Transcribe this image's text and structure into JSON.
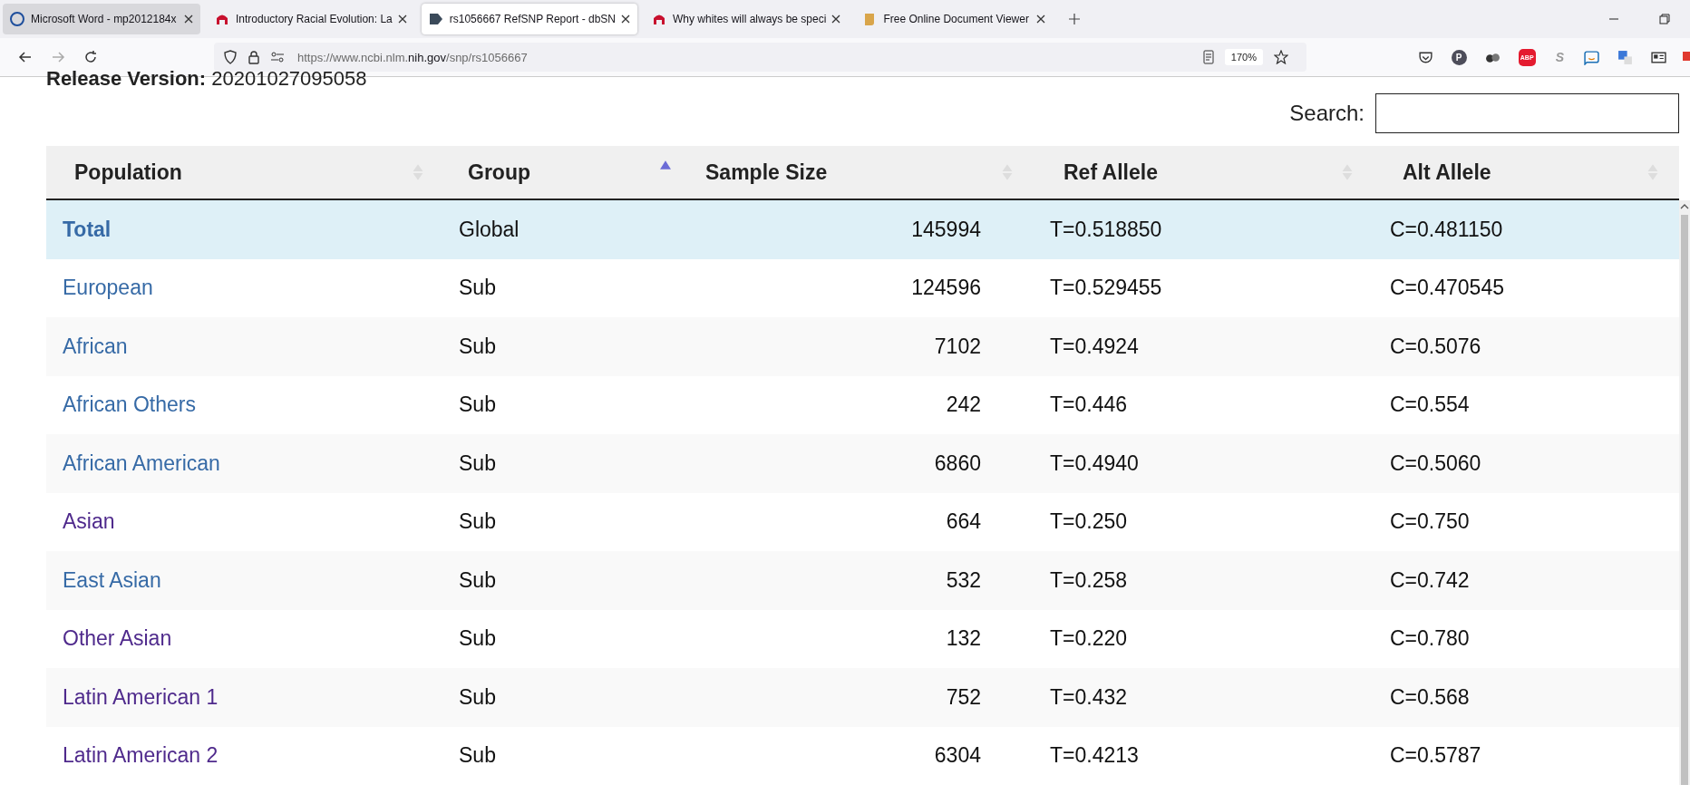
{
  "browser": {
    "tabs": [
      {
        "title": "Microsoft Word - mp2012184x",
        "selected": false,
        "kind": "globe"
      },
      {
        "title": "Introductory Racial Evolution: La",
        "selected": false,
        "kind": "hat"
      },
      {
        "title": "rs1056667 RefSNP Report - dbSN",
        "selected": true,
        "kind": "tag"
      },
      {
        "title": "Why whites will always be speci",
        "selected": false,
        "kind": "hat"
      },
      {
        "title": "Free Online Document Viewer",
        "selected": false,
        "kind": "scroll"
      }
    ],
    "url": {
      "prefix": "https://www.ncbi.nlm.",
      "domain": "nih.gov",
      "path": "/snp/rs1056667"
    },
    "zoom": "170%",
    "extensions": [
      "P",
      "ABP",
      "S"
    ]
  },
  "page": {
    "release": {
      "label": "Release Version:",
      "value": "20201027095058"
    },
    "search": {
      "label": "Search:"
    },
    "table": {
      "columns": [
        {
          "label": "Population",
          "sorted": false
        },
        {
          "label": "Group",
          "sorted": true
        },
        {
          "label": "Sample Size",
          "sorted": false
        },
        {
          "label": "Ref Allele",
          "sorted": false
        },
        {
          "label": "Alt Allele",
          "sorted": false
        }
      ],
      "rows": [
        {
          "population": "Total",
          "visited": false,
          "highlighted": true,
          "group": "Global",
          "sample_size": "145994",
          "ref_allele": "T=0.518850",
          "alt_allele": "C=0.481150"
        },
        {
          "population": "European",
          "visited": false,
          "highlighted": false,
          "group": "Sub",
          "sample_size": "124596",
          "ref_allele": "T=0.529455",
          "alt_allele": "C=0.470545"
        },
        {
          "population": "African",
          "visited": false,
          "highlighted": false,
          "group": "Sub",
          "sample_size": "7102",
          "ref_allele": "T=0.4924",
          "alt_allele": "C=0.5076"
        },
        {
          "population": "African Others",
          "visited": false,
          "highlighted": false,
          "group": "Sub",
          "sample_size": "242",
          "ref_allele": "T=0.446",
          "alt_allele": "C=0.554"
        },
        {
          "population": "African American",
          "visited": false,
          "highlighted": false,
          "group": "Sub",
          "sample_size": "6860",
          "ref_allele": "T=0.4940",
          "alt_allele": "C=0.5060"
        },
        {
          "population": "Asian",
          "visited": true,
          "highlighted": false,
          "group": "Sub",
          "sample_size": "664",
          "ref_allele": "T=0.250",
          "alt_allele": "C=0.750"
        },
        {
          "population": "East Asian",
          "visited": false,
          "highlighted": false,
          "group": "Sub",
          "sample_size": "532",
          "ref_allele": "T=0.258",
          "alt_allele": "C=0.742"
        },
        {
          "population": "Other Asian",
          "visited": true,
          "highlighted": false,
          "group": "Sub",
          "sample_size": "132",
          "ref_allele": "T=0.220",
          "alt_allele": "C=0.780"
        },
        {
          "population": "Latin American 1",
          "visited": true,
          "highlighted": false,
          "group": "Sub",
          "sample_size": "752",
          "ref_allele": "T=0.432",
          "alt_allele": "C=0.568"
        },
        {
          "population": "Latin American 2",
          "visited": true,
          "highlighted": false,
          "group": "Sub",
          "sample_size": "6304",
          "ref_allele": "T=0.4213",
          "alt_allele": "C=0.5787"
        }
      ]
    }
  }
}
